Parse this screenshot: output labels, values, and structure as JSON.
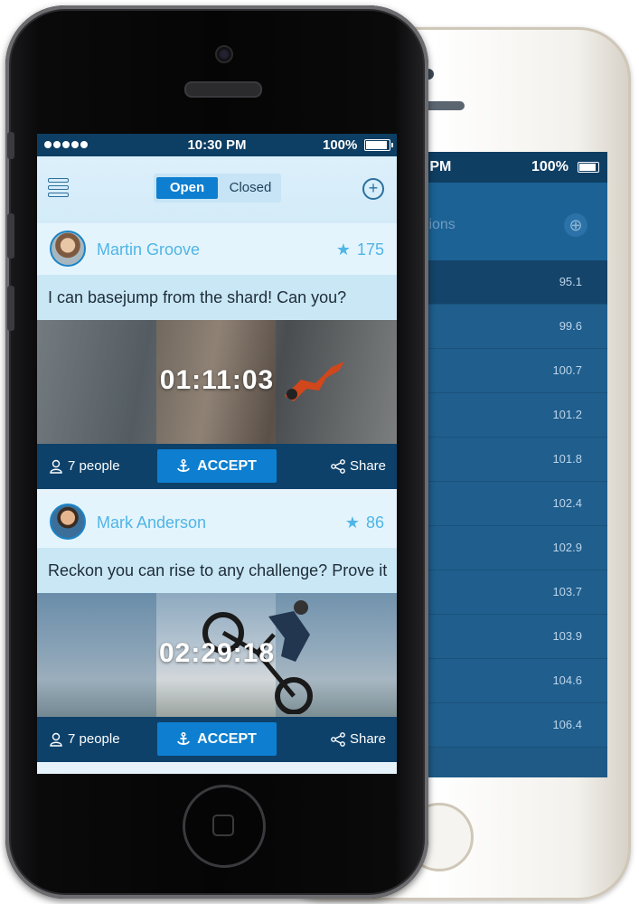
{
  "back_screen": {
    "status": {
      "time": "0 PM",
      "battery": "100%"
    },
    "header": {
      "title": "tions"
    },
    "values": [
      "95.1",
      "99.6",
      "100.7",
      "101.2",
      "101.8",
      "102.4",
      "102.9",
      "103.7",
      "103.9",
      "104.6",
      "106.4"
    ]
  },
  "status_bar": {
    "time": "10:30 PM",
    "battery": "100%"
  },
  "navbar": {
    "menu_icon": "menu-icon",
    "segment": {
      "open": "Open",
      "closed": "Closed",
      "selected": "Open"
    },
    "add_icon": "plus-circle-icon"
  },
  "cards": [
    {
      "user": "Martin Groove",
      "score": "175",
      "text": "I can basejump from the shard! Can you?",
      "timer": "01:11:03",
      "people": "7 people",
      "accept": "ACCEPT",
      "share": "Share"
    },
    {
      "user": "Mark Anderson",
      "score": "86",
      "text": "Reckon you can rise to any challenge? Prove it",
      "timer": "02:29:18",
      "people": "7 people",
      "accept": "ACCEPT",
      "share": "Share"
    }
  ],
  "colors": {
    "accent": "#0e7fd0",
    "name": "#4fb5e6",
    "bar": "#0d416a",
    "status": "#0d3e63"
  }
}
